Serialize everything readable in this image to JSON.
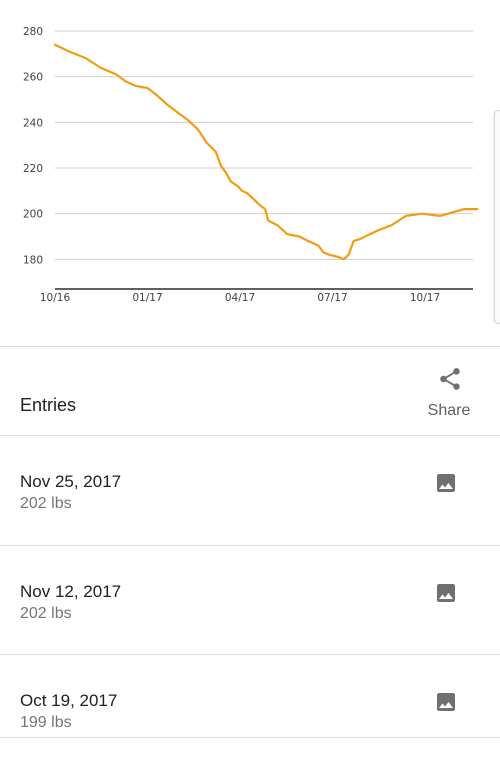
{
  "chart_data": {
    "type": "line",
    "x": [
      "2016-10-01",
      "2016-10-15",
      "2016-11-01",
      "2016-11-15",
      "2016-11-20",
      "2016-12-01",
      "2016-12-10",
      "2016-12-20",
      "2017-01-01",
      "2017-01-10",
      "2017-01-20",
      "2017-02-01",
      "2017-02-10",
      "2017-02-20",
      "2017-03-01",
      "2017-03-10",
      "2017-03-15",
      "2017-03-20",
      "2017-03-25",
      "2017-04-01",
      "2017-04-05",
      "2017-04-10",
      "2017-04-15",
      "2017-04-22",
      "2017-04-28",
      "2017-05-01",
      "2017-05-10",
      "2017-05-20",
      "2017-06-01",
      "2017-06-10",
      "2017-06-20",
      "2017-06-25",
      "2017-07-01",
      "2017-07-10",
      "2017-07-15",
      "2017-07-20",
      "2017-07-25",
      "2017-08-01",
      "2017-08-10",
      "2017-08-20",
      "2017-09-01",
      "2017-09-15",
      "2017-10-01",
      "2017-10-19",
      "2017-11-12",
      "2017-11-25"
    ],
    "series": [
      {
        "values": [
          274,
          271,
          268,
          264,
          263,
          261,
          258,
          256,
          255,
          252,
          248,
          244,
          241,
          237,
          231,
          227,
          221,
          218,
          214,
          212,
          210,
          209,
          207,
          204,
          202,
          197,
          195,
          191,
          190,
          188,
          186,
          183,
          182,
          181,
          180,
          182,
          188,
          189,
          191,
          193,
          195,
          199,
          200,
          199,
          202,
          202
        ],
        "color": "#f39c12"
      }
    ],
    "xticks": [
      "10/16",
      "01/17",
      "04/17",
      "07/17",
      "10/17"
    ],
    "yticks": [
      180,
      200,
      220,
      240,
      260,
      280
    ],
    "ylim": [
      167,
      280
    ],
    "grid": "horizontal",
    "legend": "none"
  },
  "header": {
    "title": "Entries",
    "share_label": "Share",
    "share_icon": "share-icon"
  },
  "entries": [
    {
      "date": "Nov 25, 2017",
      "weight": "202 lbs",
      "icon": "photo-icon"
    },
    {
      "date": "Nov 12, 2017",
      "weight": "202 lbs",
      "icon": "photo-icon"
    },
    {
      "date": "Oct 19, 2017",
      "weight": "199 lbs",
      "icon": "photo-icon"
    }
  ],
  "colors": {
    "line": "#f39c12",
    "grid": "#d0d0d0",
    "axis": "#000000",
    "icon": "#707070"
  }
}
